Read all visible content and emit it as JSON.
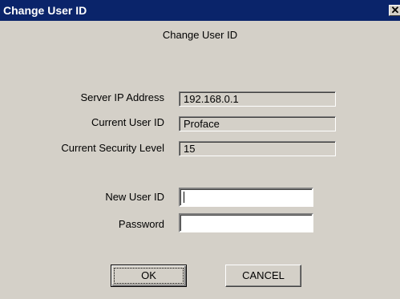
{
  "window": {
    "title": "Change User ID",
    "close_icon": "close-icon"
  },
  "heading": "Change User ID",
  "fields": {
    "server_ip": {
      "label": "Server IP Address",
      "value": "192.168.0.1"
    },
    "current_user": {
      "label": "Current User ID",
      "value": "Proface"
    },
    "security_level": {
      "label": "Current Security Level",
      "value": "15"
    },
    "new_user": {
      "label": "New User ID",
      "value": ""
    },
    "password": {
      "label": "Password",
      "value": ""
    }
  },
  "buttons": {
    "ok": "OK",
    "cancel": "CANCEL"
  }
}
